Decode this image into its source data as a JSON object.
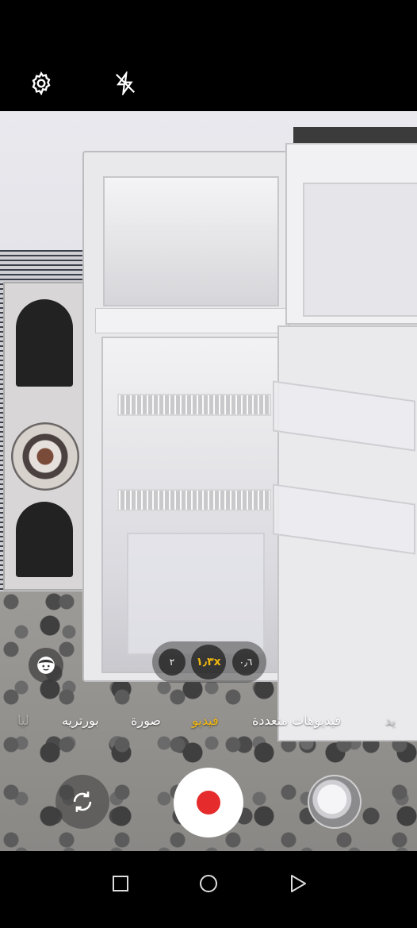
{
  "camera": {
    "zoom_levels": [
      {
        "label": "٢",
        "active": false
      },
      {
        "label": "١٫٣x",
        "active": true
      },
      {
        "label": "٠٫٦",
        "active": false
      }
    ],
    "modes": [
      {
        "label": "ليا",
        "state": "faded"
      },
      {
        "label": "بورتريه",
        "state": "normal"
      },
      {
        "label": "صورة",
        "state": "normal"
      },
      {
        "label": "فيديو",
        "state": "active"
      },
      {
        "label": "فيديوهات متعددة",
        "state": "normal"
      },
      {
        "label": "يد",
        "state": "faded"
      }
    ],
    "accent_color": "#f2b80f",
    "record_color": "#e52b2b"
  },
  "icons": {
    "settings": "gear-icon",
    "flash": "flash-off-icon",
    "beauty": "face-icon",
    "switch_camera": "switch-camera-icon",
    "gallery": "gallery-thumbnail",
    "nav_recents": "square-icon",
    "nav_home": "circle-icon",
    "nav_back": "triangle-back-icon"
  }
}
